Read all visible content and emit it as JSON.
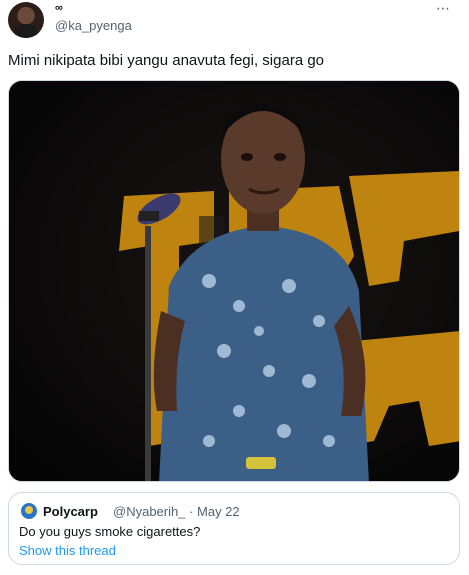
{
  "author": {
    "name": "∞",
    "handle": "@ka_pyenga"
  },
  "more_icon": "⋯",
  "tweet": {
    "text": "Mimi nikipata bibi yangu anavuta fegi, sigara go"
  },
  "media": {
    "description_icon": "video-still"
  },
  "quoted": {
    "name": "Polycarp",
    "handle_date": "@Nyaberih_ · May 22",
    "text": "Do you guys smoke cigarettes?",
    "link": "Show this thread"
  },
  "colors": {
    "link": "#1d9bf0",
    "muted": "#536471",
    "text": "#0f1419",
    "border": "#cfd9de"
  }
}
